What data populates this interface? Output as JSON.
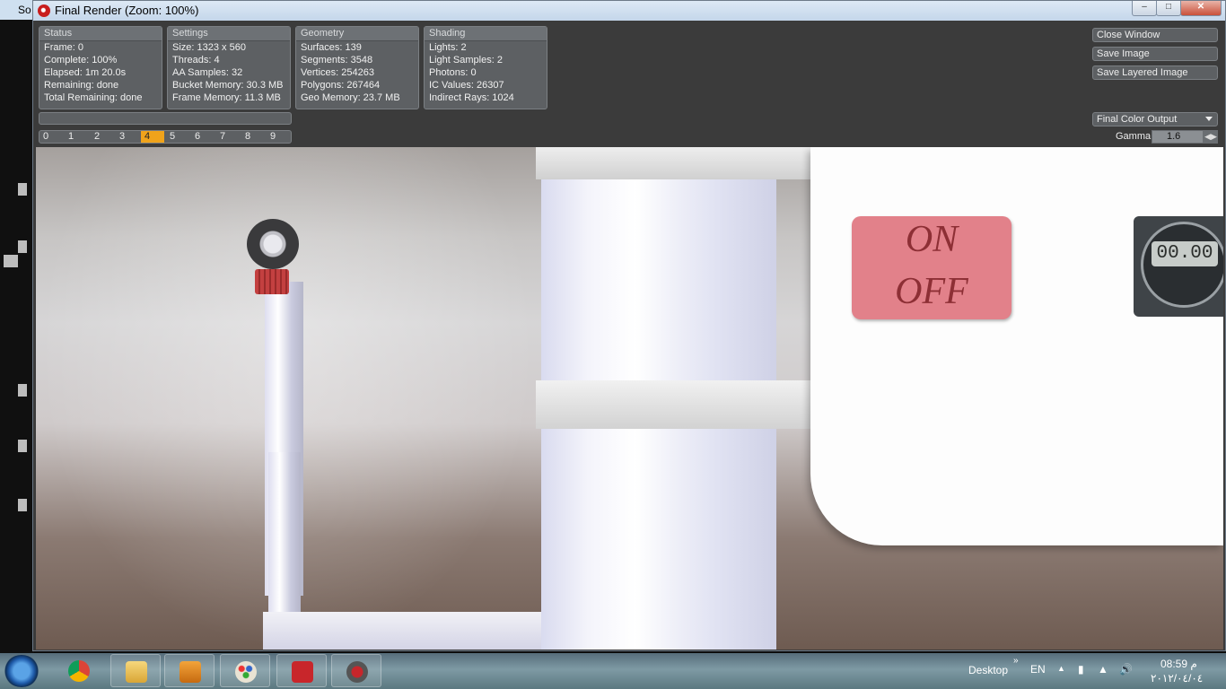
{
  "background_app": {
    "title_fragment": "So"
  },
  "window": {
    "title": "Final Render (Zoom: 100%)"
  },
  "panels": {
    "status": {
      "header": "Status",
      "rows": [
        "Frame: 0",
        "Complete: 100%",
        "Elapsed: 1m 20.0s",
        "Remaining: done",
        "Total Remaining: done"
      ]
    },
    "settings": {
      "header": "Settings",
      "rows": [
        "Size: 1323 x 560",
        "Threads: 4",
        "AA Samples: 32",
        "Bucket Memory: 30.3 MB",
        "Frame Memory: 11.3 MB"
      ]
    },
    "geometry": {
      "header": "Geometry",
      "rows": [
        "Surfaces: 139",
        "Segments: 3548",
        "Vertices: 254263",
        "Polygons: 267464",
        "Geo Memory: 23.7 MB"
      ]
    },
    "shading": {
      "header": "Shading",
      "rows": [
        "Lights: 2",
        "Light Samples: 2",
        "Photons: 0",
        "IC Values: 26307",
        "Indirect Rays: 1024"
      ]
    }
  },
  "buckets": {
    "items": [
      "0",
      "1",
      "2",
      "3",
      "4",
      "5",
      "6",
      "7",
      "8",
      "9"
    ],
    "selected": "4"
  },
  "actions": {
    "close": "Close Window",
    "save": "Save Image",
    "save_layered": "Save Layered Image"
  },
  "output": {
    "selected": "Final Color Output",
    "gamma_label": "Gamma",
    "gamma_value": "1.6"
  },
  "render": {
    "sign_on": "ON",
    "sign_off": "OFF",
    "timer_display": "00.00"
  },
  "taskbar": {
    "desktop_label": "Desktop",
    "lang": "EN",
    "time": "08:59 م",
    "date": "٢٠١٢/٠٤/٠٤",
    "apps": [
      "windows-start",
      "chrome",
      "file-explorer",
      "media-player",
      "paint",
      "solidworks",
      "solidworks-photoview"
    ]
  },
  "colors": {
    "accent_bucket": "#f0a31b",
    "panel_bg": "#5d6063",
    "window_bg": "#3b3b3b"
  }
}
